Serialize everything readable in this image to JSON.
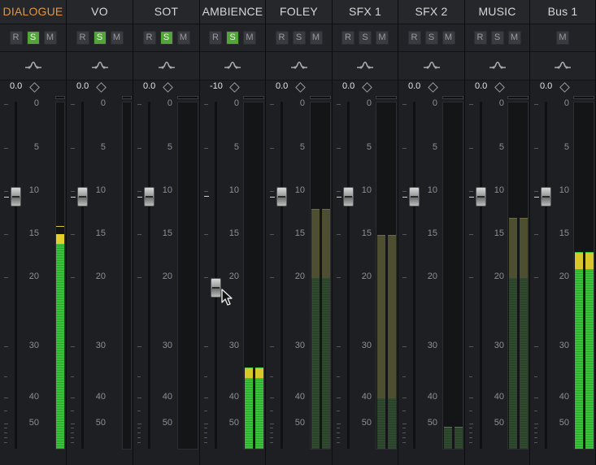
{
  "colors": {
    "accent": "#e3963c",
    "solo_on": "#52a638",
    "meter_green": "#3ac23a",
    "meter_yellow": "#d8c62a",
    "meter_dim": "#2f4a2f"
  },
  "buttons": {
    "record": "R",
    "solo": "S",
    "mute": "M"
  },
  "icons": {
    "eq": "eq-curve-icon",
    "pan": "diamond-icon",
    "cursor": "mouse-pointer-icon"
  },
  "scale_labels": [
    "0",
    "5",
    "10",
    "15",
    "20",
    "30",
    "40",
    "50"
  ],
  "tracks": [
    {
      "name": "DIALOGUE",
      "active": true,
      "volume": "0.0",
      "solo_on": true,
      "has_rs": true,
      "meter_level_db": 16,
      "peak_db": 14,
      "meter_dim": false
    },
    {
      "name": "VO",
      "active": false,
      "volume": "0.0",
      "solo_on": true,
      "has_rs": true
    },
    {
      "name": "SOT",
      "active": false,
      "volume": "0.0",
      "solo_on": true,
      "has_rs": true
    },
    {
      "name": "AMBIENCE",
      "active": false,
      "volume": "-10",
      "solo_on": true,
      "has_rs": true,
      "meter_level_db": 36,
      "peak_db": 34
    },
    {
      "name": "FOLEY",
      "active": false,
      "volume": "0.0",
      "solo_on": false,
      "has_rs": true,
      "meter_level_db": 20,
      "peak_db": 12,
      "meter_dim": true
    },
    {
      "name": "SFX 1",
      "active": false,
      "volume": "0.0",
      "solo_on": false,
      "has_rs": true,
      "meter_level_db": 40,
      "peak_db": 15,
      "meter_dim": true
    },
    {
      "name": "SFX 2",
      "active": false,
      "volume": "0.0",
      "solo_on": false,
      "has_rs": true,
      "meter_level_db": 51,
      "peak_db": 51,
      "meter_dim": true
    },
    {
      "name": "MUSIC",
      "active": false,
      "volume": "0.0",
      "solo_on": false,
      "has_rs": true,
      "meter_level_db": 20,
      "peak_db": 13,
      "meter_dim": true
    },
    {
      "name": "Bus 1",
      "active": false,
      "volume": "0.0",
      "solo_on": false,
      "has_rs": false,
      "meter_level_db": 19,
      "peak_db": 17,
      "meter_dim": false
    }
  ]
}
